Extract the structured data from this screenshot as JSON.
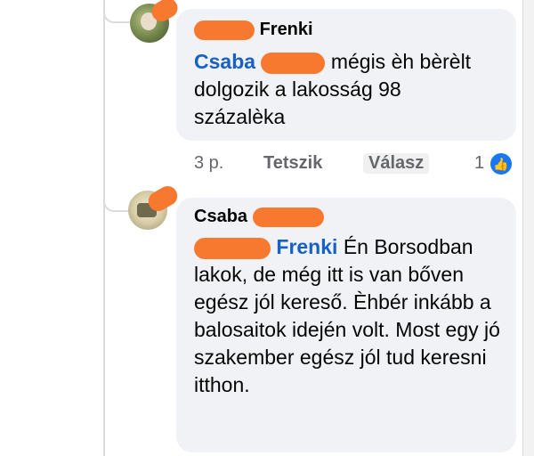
{
  "comments": [
    {
      "author_name": "Frenki",
      "mention_name": "Csaba",
      "text": "mégis èh bèrèlt dolgozik a lakosság 98 százalèka",
      "time": "3 p.",
      "like_label": "Tetszik",
      "reply_label": "Válasz",
      "reaction_count": "1",
      "reaction_icon": "thumbs-up-icon"
    },
    {
      "author_name": "Csaba",
      "mention_name": "Frenki",
      "text": "Én Borsodban lakok, de még itt is van bőven egész jól kereső. Èhbér inkább a balosaitok idején volt. Most egy jó szakember egész jól tud keresni itthon."
    }
  ],
  "colors": {
    "bubble": "#f0f2f5",
    "mention": "#1660c7",
    "meta": "#65676b",
    "redaction": "#f7792f",
    "like": "#1877f2"
  }
}
